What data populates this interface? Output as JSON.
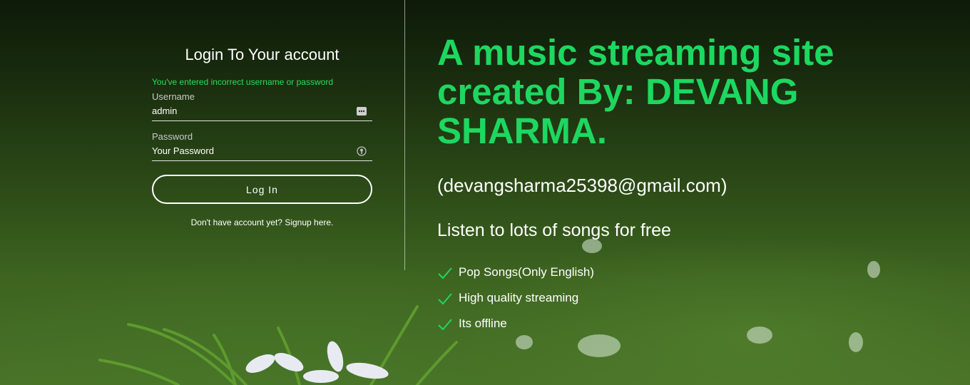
{
  "login": {
    "title": "Login To Your account",
    "error": "You've entered incorrect username or password",
    "username_label": "Username",
    "username_value": "admin",
    "password_label": "Password",
    "password_placeholder": "Your Password",
    "submit_label": "Log In",
    "signup_text": "Don't have account yet? Signup here."
  },
  "hero": {
    "heading": "A music streaming site created By: DEVANG SHARMA.",
    "email": "(devangsharma25398@gmail.com)",
    "tagline": "Listen to lots of songs for free",
    "features": [
      "Pop Songs(Only English)",
      "High quality streaming",
      "Its offline"
    ]
  },
  "icons": {
    "username_field": "dots-icon",
    "password_field": "password-key-icon",
    "feature": "checkmark-icon"
  },
  "colors": {
    "accent_green": "#1ed760",
    "error_green": "#2ddc5c",
    "text": "#ffffff"
  }
}
